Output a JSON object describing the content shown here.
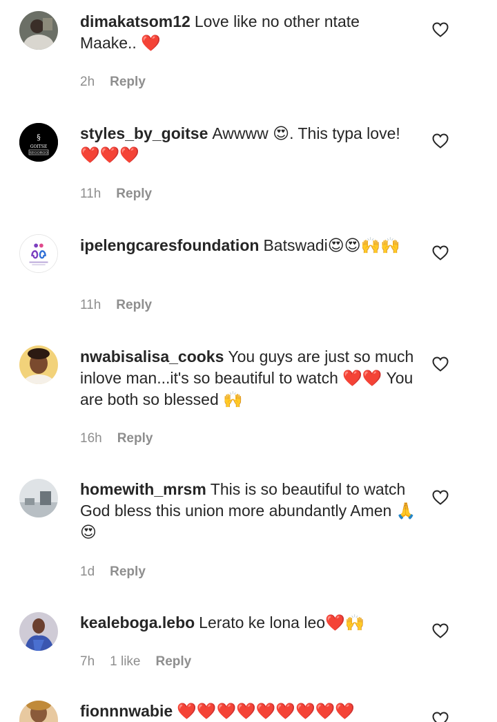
{
  "comments": [
    {
      "username": "dimakatsom12",
      "text": "Love like no other ntate Maake.. ❤️",
      "time": "2h",
      "likes": "",
      "reply_label": "Reply"
    },
    {
      "username": "styles_by_goitse",
      "text": "Awwww 😍. This typa love! ❤️❤️❤️",
      "time": "11h",
      "likes": "",
      "reply_label": "Reply",
      "avatar_text": "GOITSE",
      "avatar_sub": "SEGORGO"
    },
    {
      "username": "ipelengcaresfoundation",
      "text": "Batswadi😍😍🙌🙌",
      "time": "11h",
      "likes": "",
      "reply_label": "Reply"
    },
    {
      "username": "nwabisalisa_cooks",
      "text": "You guys are just so much inlove man...it's so beautiful to watch ❤️❤️ You are both so blessed 🙌",
      "time": "16h",
      "likes": "",
      "reply_label": "Reply"
    },
    {
      "username": "homewith_mrsm",
      "text": "This is so beautiful to watch God bless this union more abundantly Amen 🙏😍",
      "time": "1d",
      "likes": "",
      "reply_label": "Reply"
    },
    {
      "username": "kealeboga.lebo",
      "text": "Lerato ke lona leo❤️🙌",
      "time": "7h",
      "likes": "1 like",
      "reply_label": "Reply"
    },
    {
      "username": "fionnnwabie",
      "text": "❤️❤️❤️❤️❤️❤️❤️❤️❤️",
      "time": "",
      "likes": "",
      "reply_label": ""
    }
  ],
  "icons": {
    "like": "heart-outline-icon"
  },
  "colors": {
    "text": "#262626",
    "meta": "#8e8e8e",
    "heart": "#e0202b"
  }
}
